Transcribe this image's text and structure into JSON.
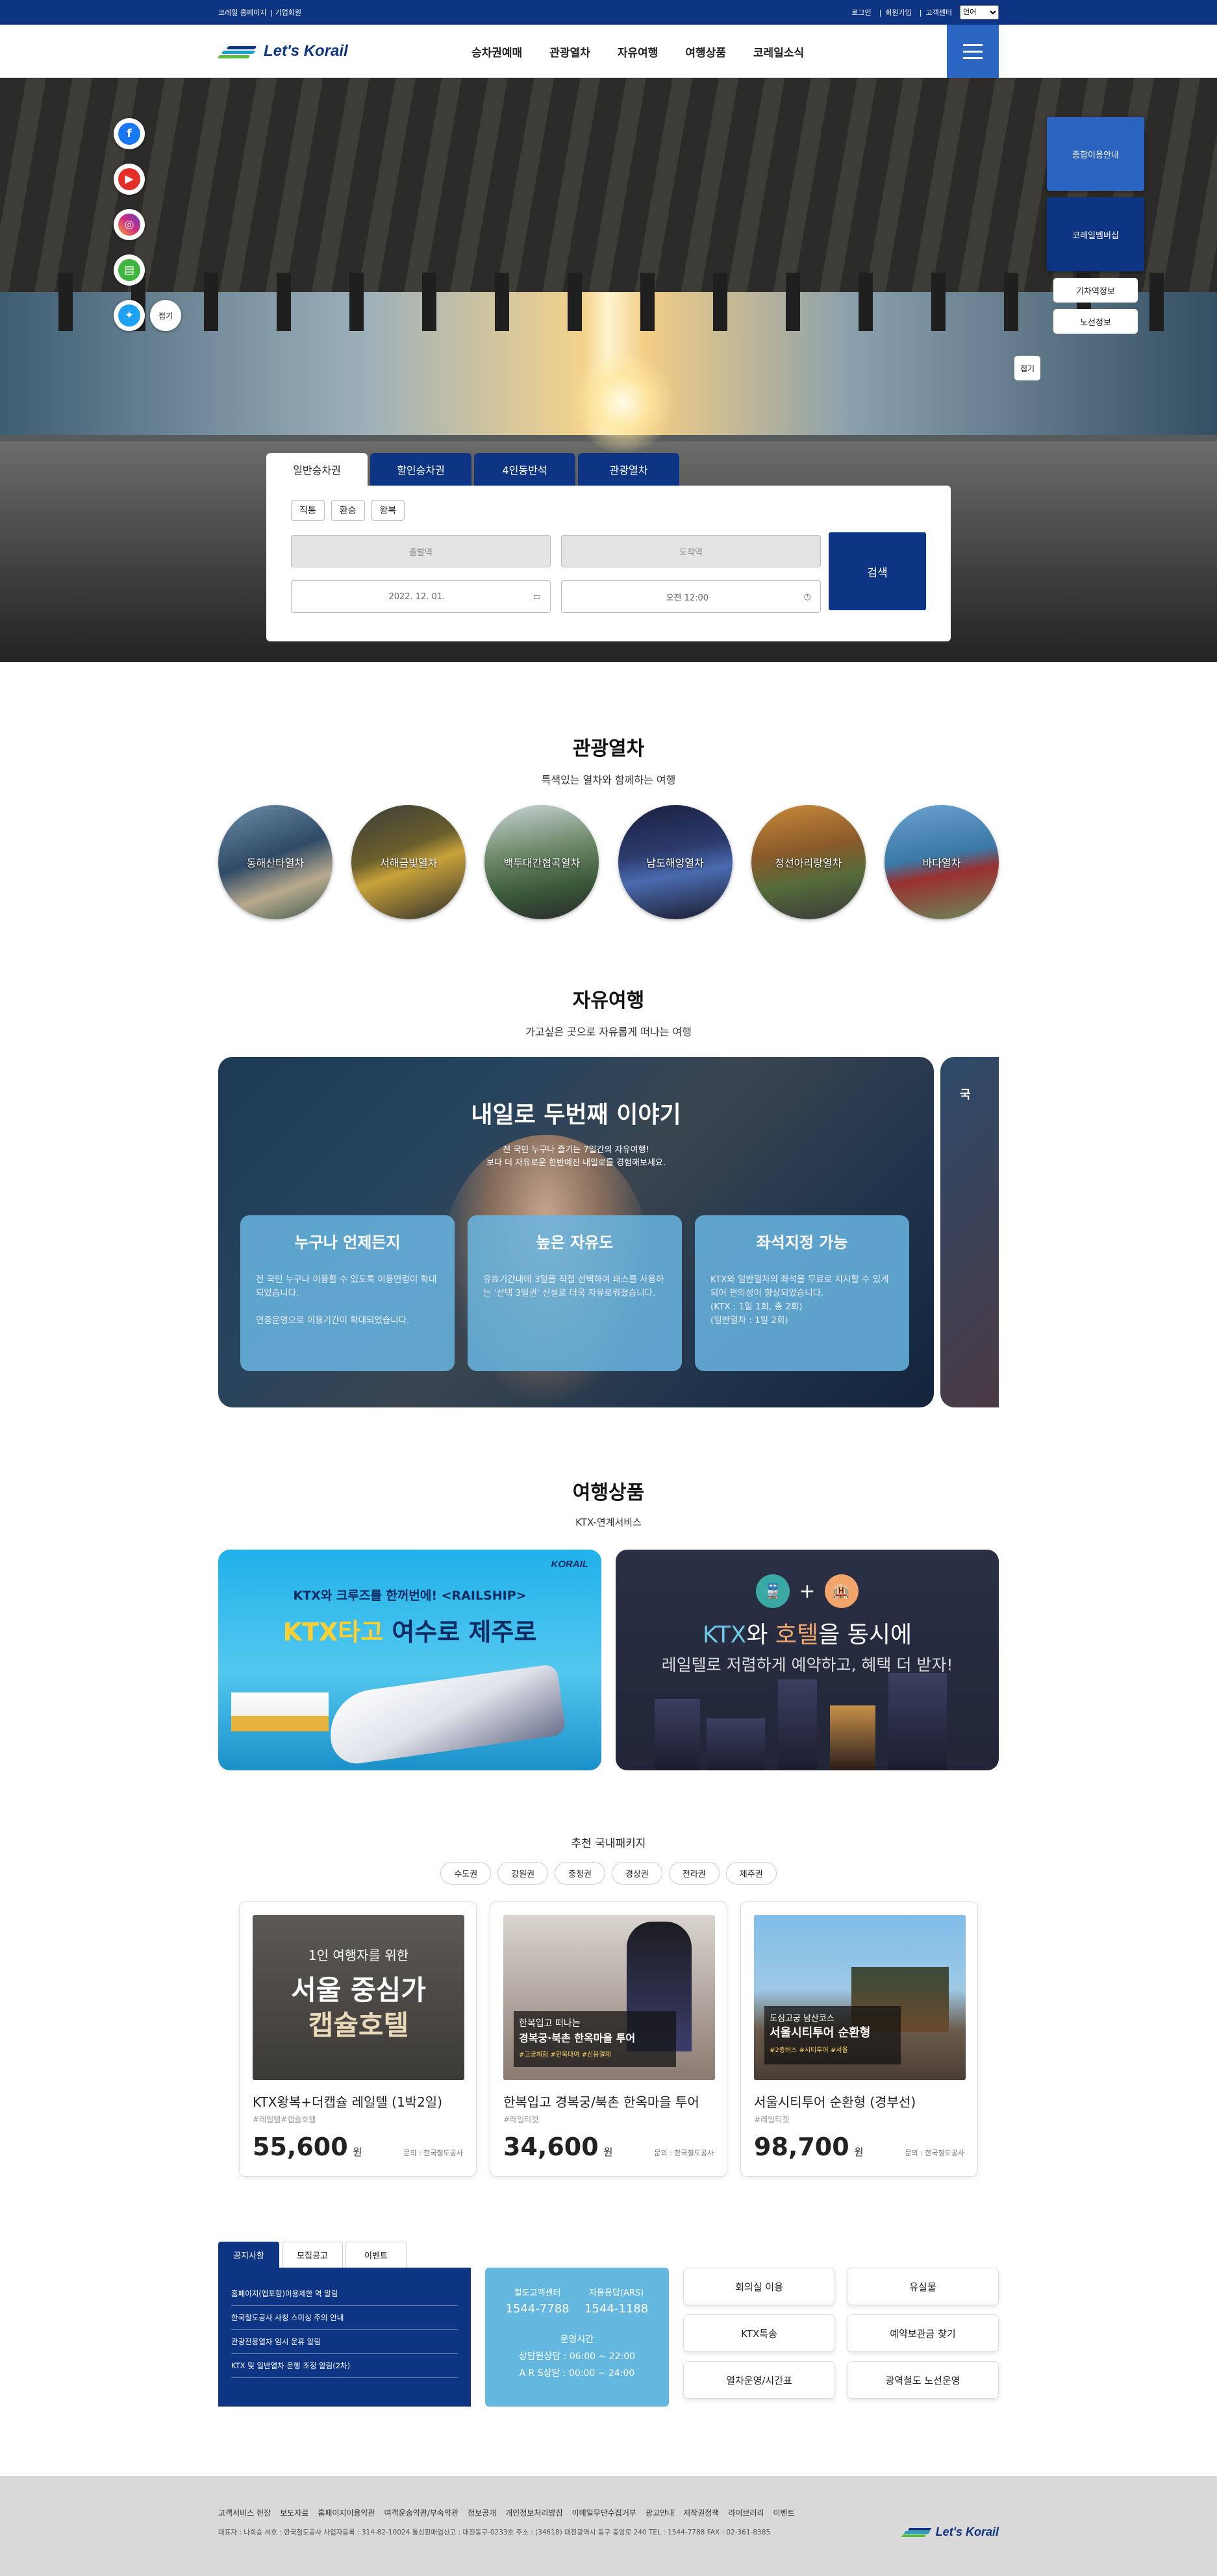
{
  "util": {
    "left": [
      "코레일 홈페이지",
      "기업회원"
    ],
    "right": [
      "로그인",
      "회원가입",
      "고객센터"
    ],
    "lang": "언어"
  },
  "logo": "Let's Korail",
  "menu": [
    "승차권예매",
    "관광열차",
    "자유여행",
    "여행상품",
    "코레일소식"
  ],
  "sns": {
    "close": "접기"
  },
  "quick": {
    "big1": "종합이용안내",
    "big2": "코레일멤버십",
    "sm1": "기차역정보",
    "sm2": "노선정보",
    "fold": "접기"
  },
  "booking": {
    "tabs": [
      "일반승차권",
      "할인승차권",
      "4인동반석",
      "관광열차"
    ],
    "trip": [
      "직통",
      "환승",
      "왕복"
    ],
    "from": "출발역",
    "to": "도착역",
    "date": "2022. 12. 01.",
    "time": "오전 12:00",
    "search": "검색"
  },
  "tour": {
    "title": "관광열차",
    "sub": "특색있는 열차와 함께하는 여행",
    "items": [
      "동해산타열차",
      "서해금빛열차",
      "백두대간협곡열차",
      "남도해양열차",
      "정선아리랑열차",
      "바다열차"
    ]
  },
  "free": {
    "title": "자유여행",
    "sub": "가고싶은 곳으로 자유롭게 떠나는 여행",
    "slide_title": "내일로 두번째 이야기",
    "slide_sub1": "전 국민 누구나 즐기는 7일간의 자유여행!",
    "slide_sub2": "보다 더 자유로운 한반예진 내일로를 경험해보세요.",
    "cards": [
      {
        "title": "누구나 언제든지",
        "body": "전 국민 누구나 이용할 수 있도록 이용연령이 확대되었습니다.\n\n연중운영으로 이용기간이 확대되었습니다."
      },
      {
        "title": "높은 자유도",
        "body": "유효기간내에 3일을 직접 선택하여 패스를 사용하는 '선택 3일권' 신설로 더욱 자유로워졌습니다."
      },
      {
        "title": "좌석지정 가능",
        "body": "KTX와 일반열차의 좌석을 무료로 지지할 수 있게되어 편의성이 향상되었습니다.\n(KTX : 1일 1회, 총 2회)\n(일반열차 : 1일 2회)"
      }
    ],
    "next_peek": "국"
  },
  "pkg": {
    "title": "여행상품",
    "sub": "KTX-연계서비스",
    "b1": {
      "brand": "KORAIL",
      "line1": "KTX와 크루즈를 한꺼번에! <RAILSHIP>",
      "hl": "KTX타고",
      "line2": "여수로 제주로"
    },
    "b2": {
      "a": "KTX",
      "w1": "와 ",
      "b": "호텔",
      "w2": "을 동시에",
      "line2": "레일텔로 저렴하게 예약하고, 혜택 더 받자!"
    }
  },
  "recom": {
    "title": "추천 국내패키지",
    "regions": [
      "수도권",
      "강원권",
      "충청권",
      "경상권",
      "전라권",
      "제주권"
    ],
    "products": [
      {
        "img1": "1인 여행자를 위한",
        "img2": "서울 중심가",
        "img3": "캡슐호텔",
        "name": "KTX왕복+더캡슐 레일텔 (1박2일)",
        "tag": "#레일텔#캡슐호텔",
        "price": "55,600",
        "won": "원",
        "org": "문의 : 한국철도공사"
      },
      {
        "img1": "한복입고 떠나는",
        "img2": "경복궁·북촌 한옥마을 투어",
        "img3": "#고궁체험 #한복대여 #신용결제",
        "name": "한복입고 경복궁/북촌 한옥마을 투어",
        "tag": "#레일티켓",
        "price": "34,600",
        "won": "원",
        "org": "문의 : 한국철도공사"
      },
      {
        "img1": "도심고궁 남산코스",
        "img2": "서울시티투어 순환형",
        "img3": "#2층버스 #시티투어 #서울",
        "name": "서울시티투어 순환형 (경부선)",
        "tag": "#레일티켓",
        "price": "98,700",
        "won": "원",
        "org": "문의 : 한국철도공사"
      }
    ]
  },
  "notice": {
    "tabs": [
      "공지사항",
      "모집공고",
      "이벤트"
    ],
    "items": [
      "홈페이지(앱포함)이용제한 역 알림",
      "한국철도공사 사칭 스미싱 주의 안내",
      "관광전용열차 임시 운휴 알림",
      "KTX 및 일반열차 운행 조정 알림(2차)"
    ]
  },
  "call": {
    "c1": "철도고객센터",
    "c1v": "1544-7788",
    "c2": "자동응답(ARS)",
    "c2v": "1544-1188",
    "op": "운영시간",
    "op1": "상담원상담 : 06:00 ~ 22:00",
    "op2": "A R S상담 : 00:00 ~ 24:00"
  },
  "btns": [
    "회의실 이용",
    "유실물",
    "KTX특송",
    "예약보관금 찾기",
    "열차운영/시간표",
    "광역철도 노선운영"
  ],
  "footer": {
    "links": [
      "고객서비스 헌장",
      "보도자료",
      "홈페이지이용약관",
      "여객운송약관/부속약관",
      "정보공개",
      "개인정보처리방침",
      "이메일무단수집거부",
      "광고안내",
      "저작권정책",
      "라이브러리",
      "이벤트"
    ],
    "addr": "대표자 : 나희승   서호 : 한국철도공사   사업자등록 : 314-82-10024   통신판매업신고 : 대전동구-0233호   주소 : (34618) 대전광역시 동구 중앙로 240   TEL : 1544-7788   FAX : 02-361-8385",
    "logo": "Let's Korail"
  },
  "colors": {
    "navy": "#0d3583",
    "blue": "#2c66c3",
    "sky": "#64b8df"
  }
}
